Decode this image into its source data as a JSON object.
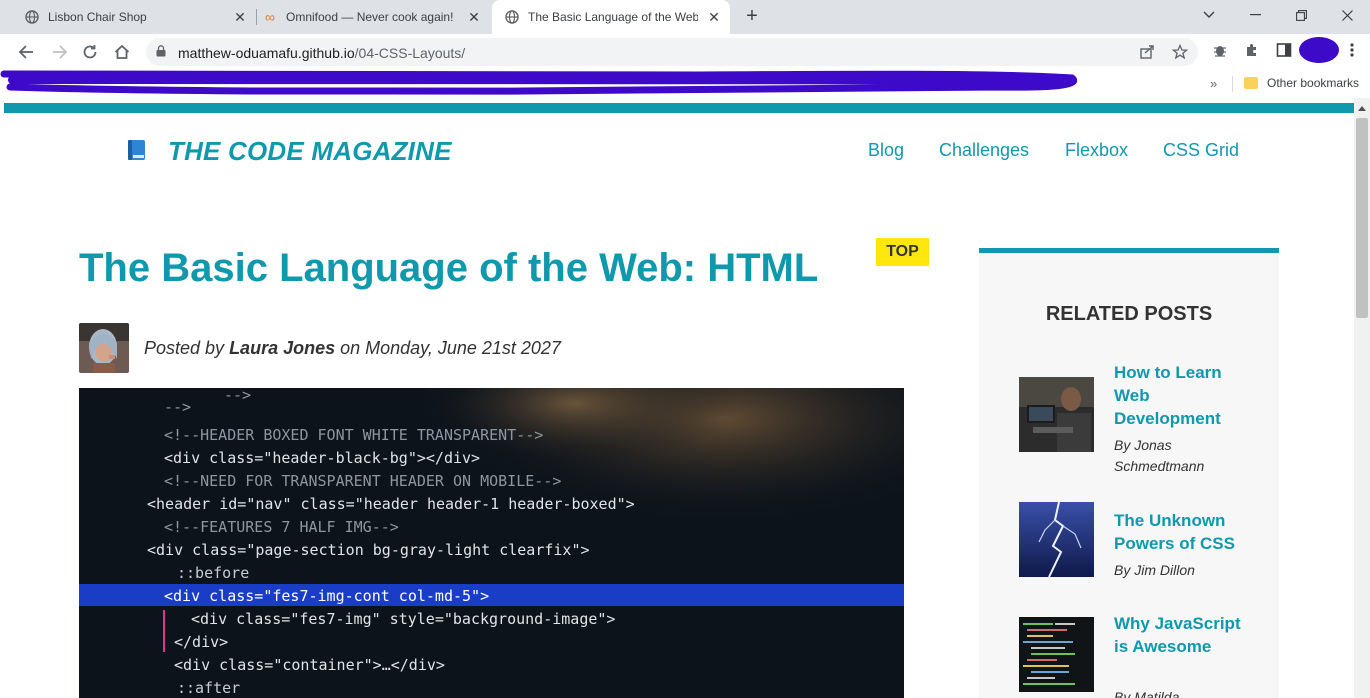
{
  "tabs": [
    {
      "title": "Lisbon Chair Shop",
      "icon": "globe-icon"
    },
    {
      "title": "Omnifood — Never cook again!",
      "icon": "omnifood-logo-icon"
    },
    {
      "title": "The Basic Language of the Web: HTML",
      "icon": "globe-icon",
      "active": true
    }
  ],
  "address_bar": {
    "url_host": "matthew-oduamafu.github.io",
    "url_path": "/04-CSS-Layouts/"
  },
  "bookmarks": {
    "overflow": "»",
    "other": "Other bookmarks"
  },
  "site": {
    "logo_icon": "blue-book-emoji",
    "logo_text": "THE CODE MAGAZINE",
    "nav": [
      "Blog",
      "Challenges",
      "Flexbox",
      "CSS Grid"
    ]
  },
  "article": {
    "tag": "TOP",
    "title": "The Basic Language of the Web: HTML",
    "byline_prefix": "Posted by ",
    "author": "Laura Jones",
    "byline_suffix": " on Monday, June 21st 2027"
  },
  "code_image": {
    "lines": [
      "<!--HEADER BOXED FONT WHITE TRANSPARENT-->",
      "<div class=\"header-black-bg\"></div>",
      "<!--NEED FOR TRANSPARENT HEADER ON MOBILE-->",
      "<header id=\"nav\" class=\"header header-1 header-boxed\">",
      "<!--FEATURES 7 HALF IMG-->",
      "<div class=\"page-section bg-gray-light clearfix\">",
      "::before",
      "<div class=\"fes7-img-cont col-md-5\">",
      "<div class=\"fes7-img\" style=\"background-image\">",
      "</div>",
      "<div class=\"container\">…</div>",
      "::after"
    ]
  },
  "related": {
    "title": "RELATED POSTS",
    "posts": [
      {
        "title": "How to Learn Web Development",
        "author": "By Jonas Schmedtmann"
      },
      {
        "title": "The Unknown Powers of CSS",
        "author": "By Jim Dillon"
      },
      {
        "title": "Why JavaScript is Awesome",
        "author": "By Matilda"
      }
    ]
  },
  "colors": {
    "accent": "#1098ad",
    "tag": "#ffe70e",
    "text": "#333333",
    "aside_bg": "#f7f7f7"
  }
}
